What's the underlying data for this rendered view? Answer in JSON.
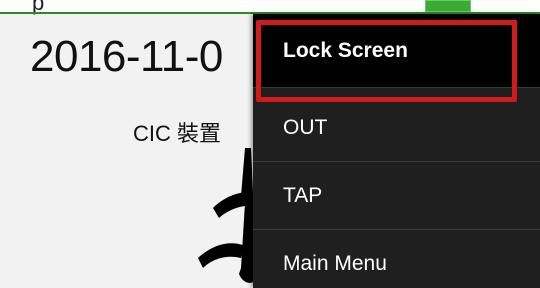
{
  "status": {
    "top_text": "p"
  },
  "main": {
    "date": "2016-11-0",
    "device_label": "CIC 裝置"
  },
  "menu": {
    "items": [
      {
        "label": "Lock Screen"
      },
      {
        "label": "OUT"
      },
      {
        "label": "TAP"
      },
      {
        "label": "Main Menu"
      }
    ]
  },
  "colors": {
    "menu_bg": "#1f1f1f",
    "highlight": "#d11a1a",
    "green_button": "#3aaa35"
  }
}
